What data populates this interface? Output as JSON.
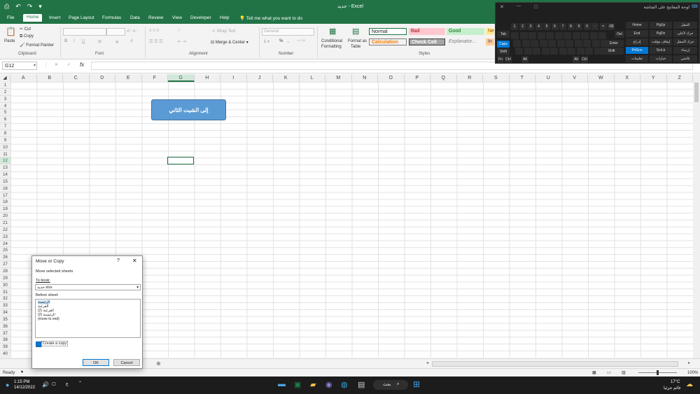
{
  "titlebar": {
    "doc_title": "جديد - Excel"
  },
  "tabs": [
    "File",
    "Home",
    "Insert",
    "Page Layout",
    "Formulas",
    "Data",
    "Review",
    "View",
    "Developer",
    "Help"
  ],
  "tell_me": "Tell me what you want to do",
  "ribbon": {
    "clipboard": {
      "paste": "Paste",
      "cut": "Cut",
      "copy": "Copy",
      "format_painter": "Format Painter",
      "label": "Clipboard"
    },
    "font": {
      "label": "Font"
    },
    "alignment": {
      "wrap_text": "Wrap Text",
      "merge_center": "Merge & Center",
      "label": "Alignment"
    },
    "number": {
      "format": "General",
      "percent": "%",
      "comma": ",",
      "label": "Number"
    },
    "styles": {
      "conditional": "Conditional",
      "conditional2": "Formatting",
      "format_as": "Format as",
      "format_as2": "Table",
      "normal": "Normal",
      "bad": "Bad",
      "good": "Good",
      "neutral": "Ne",
      "calculation": "Calculation",
      "check_cell": "Check Cell",
      "explanatory": "Explanator...",
      "input": "In",
      "label": "Styles"
    }
  },
  "formula_bar": {
    "name_box": "G12",
    "fx": "fx",
    "cancel": "✕",
    "confirm": "✓"
  },
  "columns": [
    "A",
    "B",
    "C",
    "D",
    "E",
    "F",
    "G",
    "H",
    "I",
    "J",
    "K",
    "L",
    "M",
    "N",
    "O",
    "P",
    "Q",
    "R",
    "S",
    "T",
    "U",
    "V",
    "W",
    "X",
    "Y",
    "Z"
  ],
  "selected_column": "G",
  "rows": [
    "1",
    "2",
    "3",
    "4",
    "5",
    "6",
    "7",
    "8",
    "9",
    "10",
    "11",
    "12",
    "13",
    "14",
    "15",
    "16",
    "17",
    "18",
    "19",
    "20",
    "21",
    "22",
    "23",
    "24",
    "25",
    "26",
    "27",
    "28",
    "29",
    "30",
    "31",
    "32",
    "33",
    "34",
    "35",
    "36",
    "37",
    "38",
    "39",
    "40"
  ],
  "selected_row": "12",
  "shape_text": "إلى الشيت الثاني",
  "dialog": {
    "title": "Move or Copy",
    "help": "?",
    "close": "✕",
    "move_selected": "Move selected sheets",
    "to_book_label": "To book:",
    "to_book_value": "جديد.xlsx",
    "before_sheet_label": "Before sheet:",
    "sheets": [
      "الرئيسية",
      "الفرعية",
      "الفرعية (2)",
      "الرئيسية (2)",
      "(move to end)"
    ],
    "create_copy": "Create a copy",
    "ok": "OK",
    "cancel": "Cancel"
  },
  "status": {
    "ready": "Ready",
    "zoom": "100%"
  },
  "taskbar": {
    "time": "1:15 PM",
    "date": "14/12/2022",
    "search": "بحث",
    "temp": "17°C",
    "weather": "غائم جزئيا"
  },
  "osk": {
    "title": "لوحة المفاتيح على الشاشة",
    "keys_row1": [
      "1",
      "2",
      "3",
      "4",
      "5",
      "6",
      "7",
      "8",
      "9",
      "0",
      "-",
      "=",
      "⌫"
    ],
    "left_keys": [
      "Tab",
      "Caps",
      "Shift",
      "Fn",
      "Ctrl",
      "Alt"
    ],
    "nav_keys": [
      "Home",
      "PgUp",
      "End",
      "PgDn",
      "Del",
      "Enter",
      "Shift",
      "PrtScn",
      "ScrLk",
      "Alt",
      "Ctrl"
    ],
    "ar_labels": [
      "التنقل",
      "حرك لأعلى",
      "إيقاف مؤقت",
      "حرك لأسفل",
      "إدراج",
      "إرساء",
      "خيارات",
      "تعليمات",
      "تلاشي"
    ]
  },
  "colors": {
    "excel_green": "#217346",
    "shape_blue": "#5b9bd5",
    "bad_fill": "#ffc7ce",
    "good_fill": "#c6efce",
    "neutral_fill": "#ffeb9c"
  }
}
